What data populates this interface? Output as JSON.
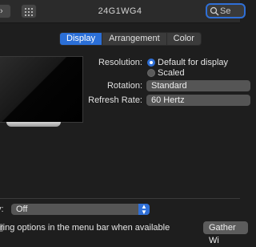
{
  "window": {
    "title": "24G1WG4"
  },
  "search": {
    "placeholder": "Se"
  },
  "tabs": [
    {
      "label": "Display",
      "active": true
    },
    {
      "label": "Arrangement",
      "active": false
    },
    {
      "label": "Color",
      "active": false
    }
  ],
  "resolution": {
    "label": "Resolution:",
    "options": [
      {
        "label": "Default for display",
        "selected": true
      },
      {
        "label": "Scaled",
        "selected": false
      }
    ]
  },
  "rotation": {
    "label": "Rotation:",
    "value": "Standard"
  },
  "refresh_rate": {
    "label": "Refresh Rate:",
    "value": "60 Hertz"
  },
  "airplay": {
    "label_fragment": "y:",
    "value": "Off"
  },
  "mirroring": {
    "text": "ring options in the menu bar when available"
  },
  "gather_button": {
    "label": "Gather Wi"
  },
  "colors": {
    "accent": "#2f6fd6",
    "background": "#1e1e1e"
  }
}
